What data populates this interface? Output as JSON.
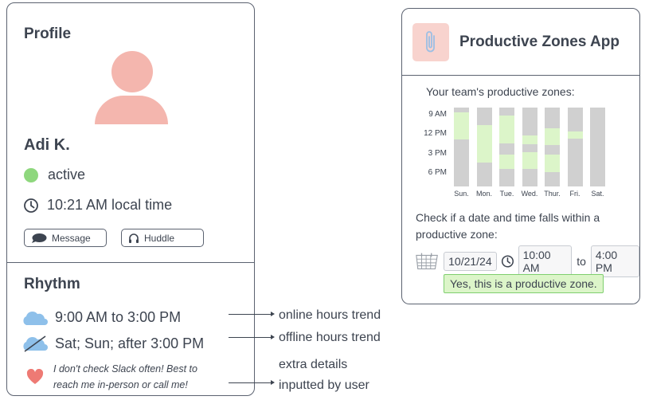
{
  "profile": {
    "title": "Profile",
    "name": "Adi K.",
    "status": "active",
    "local_time": "10:21 AM local time",
    "buttons": {
      "message": "Message",
      "huddle": "Huddle"
    }
  },
  "rhythm": {
    "title": "Rhythm",
    "online_hours": "9:00 AM to 3:00 PM",
    "offline_hours": "Sat; Sun; after 3:00 PM",
    "note_line1": "I don't check Slack often! Best to",
    "note_line2": "reach me in-person or call me!"
  },
  "annotations": {
    "online": "online hours trend",
    "offline": "offline hours trend",
    "extra_line1": "extra details",
    "extra_line2": "inputted by user"
  },
  "app": {
    "title": "Productive Zones App",
    "zones_heading": "Your team's productive zones:",
    "check_text": "Check if a date and time falls within a productive zone:",
    "date": "10/21/24",
    "time_from": "10:00 AM",
    "to_label": "to",
    "time_to": "4:00 PM",
    "result": "Yes, this is a productive zone."
  },
  "chart_data": {
    "type": "bar",
    "categories": [
      "Sun.",
      "Mon.",
      "Tue.",
      "Wed.",
      "Thur.",
      "Fri.",
      "Sat."
    ],
    "y_ticks": [
      "9 AM",
      "12 PM",
      "3 PM",
      "6 PM"
    ],
    "ylim": [
      0,
      1
    ],
    "zones": [
      [
        [
          0.06,
          0.4
        ]
      ],
      [
        [
          0.22,
          0.7
        ]
      ],
      [
        [
          0.1,
          0.45
        ],
        [
          0.6,
          0.78
        ]
      ],
      [
        [
          0.35,
          0.46
        ],
        [
          0.57,
          0.78
        ]
      ],
      [
        [
          0.26,
          0.47
        ],
        [
          0.6,
          0.82
        ]
      ],
      [
        [
          0.3,
          0.39
        ]
      ],
      []
    ],
    "colors": {
      "track": "#d0d0d0",
      "zone": "#dcf5c9"
    }
  },
  "colors": {
    "status_active": "#8ed77d",
    "avatar": "#f4b6ae",
    "accent_green": "#7fcf6e"
  }
}
